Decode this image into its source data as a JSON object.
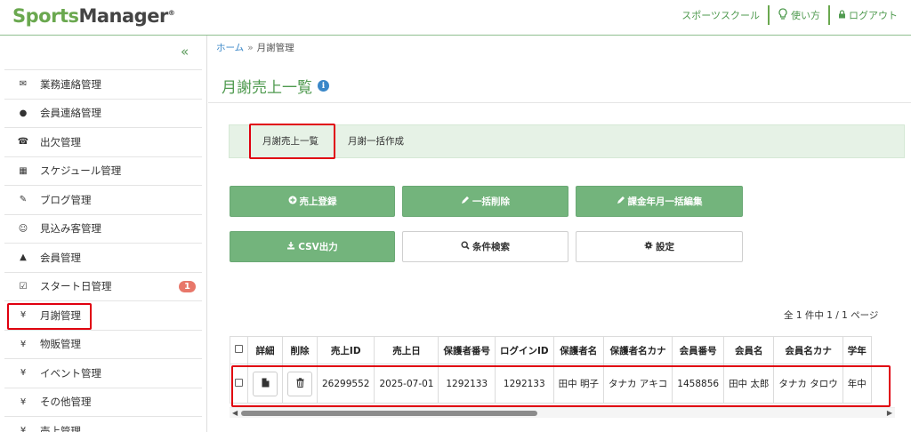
{
  "header": {
    "logo": {
      "part1": "Sports",
      "part2": "Manager",
      "mark": "®"
    },
    "links": {
      "school": "スポーツスクール",
      "usage": "使い方",
      "logout": "ログアウト"
    },
    "icons": {
      "usage": "lightbulb-icon",
      "logout": "lock-icon"
    }
  },
  "sidebar": {
    "collapse": "«",
    "items": [
      {
        "label": "業務連絡管理",
        "icon": "envelope-icon"
      },
      {
        "label": "会員連絡管理",
        "icon": "comment-icon"
      },
      {
        "label": "出欠管理",
        "icon": "phone-icon"
      },
      {
        "label": "スケジュール管理",
        "icon": "calendar-icon"
      },
      {
        "label": "ブログ管理",
        "icon": "pencil-icon"
      },
      {
        "label": "見込み客管理",
        "icon": "smile-icon"
      },
      {
        "label": "会員管理",
        "icon": "user-icon"
      },
      {
        "label": "スタート日管理",
        "icon": "checkbox-icon",
        "badge": "1"
      },
      {
        "label": "月謝管理",
        "icon": "yen-icon"
      },
      {
        "label": "物販管理",
        "icon": "yen-icon"
      },
      {
        "label": "イベント管理",
        "icon": "yen-icon"
      },
      {
        "label": "その他管理",
        "icon": "yen-icon"
      },
      {
        "label": "売上管理",
        "icon": "yen-icon"
      }
    ]
  },
  "breadcrumb": {
    "home": "ホーム",
    "sep": "»",
    "current": "月謝管理"
  },
  "page": {
    "title": "月謝売上一覧",
    "info_icon": "i"
  },
  "tabs": [
    {
      "label": "月謝売上一覧"
    },
    {
      "label": "月謝一括作成"
    }
  ],
  "buttons": {
    "add_sale": "売上登録",
    "bulk_delete": "一括削除",
    "bulk_edit": "課金年月一括編集",
    "csv": "CSV出力",
    "search": "条件検索",
    "settings": "設定"
  },
  "pagination": {
    "info": "全 1 件中 1 / 1 ページ"
  },
  "table": {
    "headers": [
      "",
      "詳細",
      "削除",
      "売上ID",
      "売上日",
      "保護者番号",
      "ログインID",
      "保護者名",
      "保護者名カナ",
      "会員番号",
      "会員名",
      "会員名カナ",
      "学年"
    ],
    "rows": [
      {
        "sale_id": "26299552",
        "date": "2025-07-01",
        "guardian_no": "1292133",
        "login_id": "1292133",
        "guardian_name": "田中 明子",
        "guardian_kana": "タナカ アキコ",
        "member_no": "1458856",
        "member_name": "田中 太郎",
        "member_kana": "タナカ タロウ",
        "grade": "年中"
      }
    ]
  },
  "colors": {
    "accent": "#73b47c",
    "title_green": "#4f9a4f",
    "highlight": "#e0000f",
    "badge": "#e8776a",
    "link_blue": "#3a87c8"
  }
}
